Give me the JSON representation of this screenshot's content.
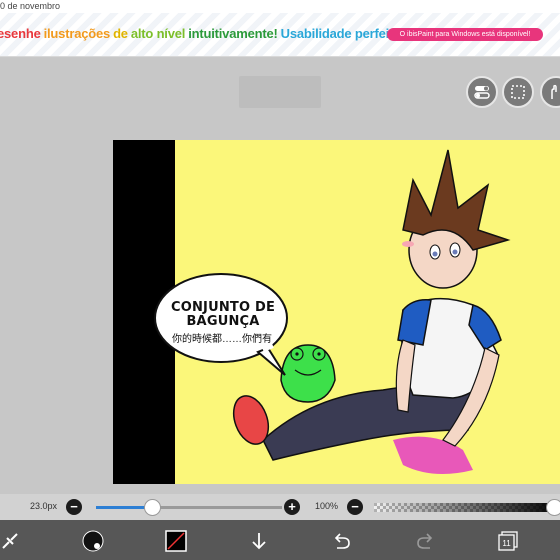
{
  "status_bar": {
    "date_text": "0 de novembro"
  },
  "banner": {
    "segments": [
      {
        "text": "esenhe",
        "color": "#e8383d"
      },
      {
        "text": "ilustrações",
        "color": "#f29a1d"
      },
      {
        "text": "de",
        "color": "#e0b400"
      },
      {
        "text": "alto nível",
        "color": "#7cbf2a"
      },
      {
        "text": "intuitivamente!",
        "color": "#2b9a3a"
      },
      {
        "text": "Usabilidade perfeita!",
        "color": "#2aa7d8"
      }
    ],
    "pill_text": "O ibisPaint para Windows está disponível!"
  },
  "canvas": {
    "bubble_title": "CONJUNTO DE BAGUNÇA",
    "bubble_subtitle": "你的時候都……你們有"
  },
  "brush": {
    "size_label": "23.0px",
    "size_fraction": 0.3
  },
  "opacity": {
    "label": "100%",
    "fraction": 1.0
  },
  "toolbar": {
    "layers_count": "11"
  },
  "colors": {
    "accent": "#2d7fd4",
    "toolbar_bg": "#575757",
    "canvas_bg": "#fbf77a"
  }
}
